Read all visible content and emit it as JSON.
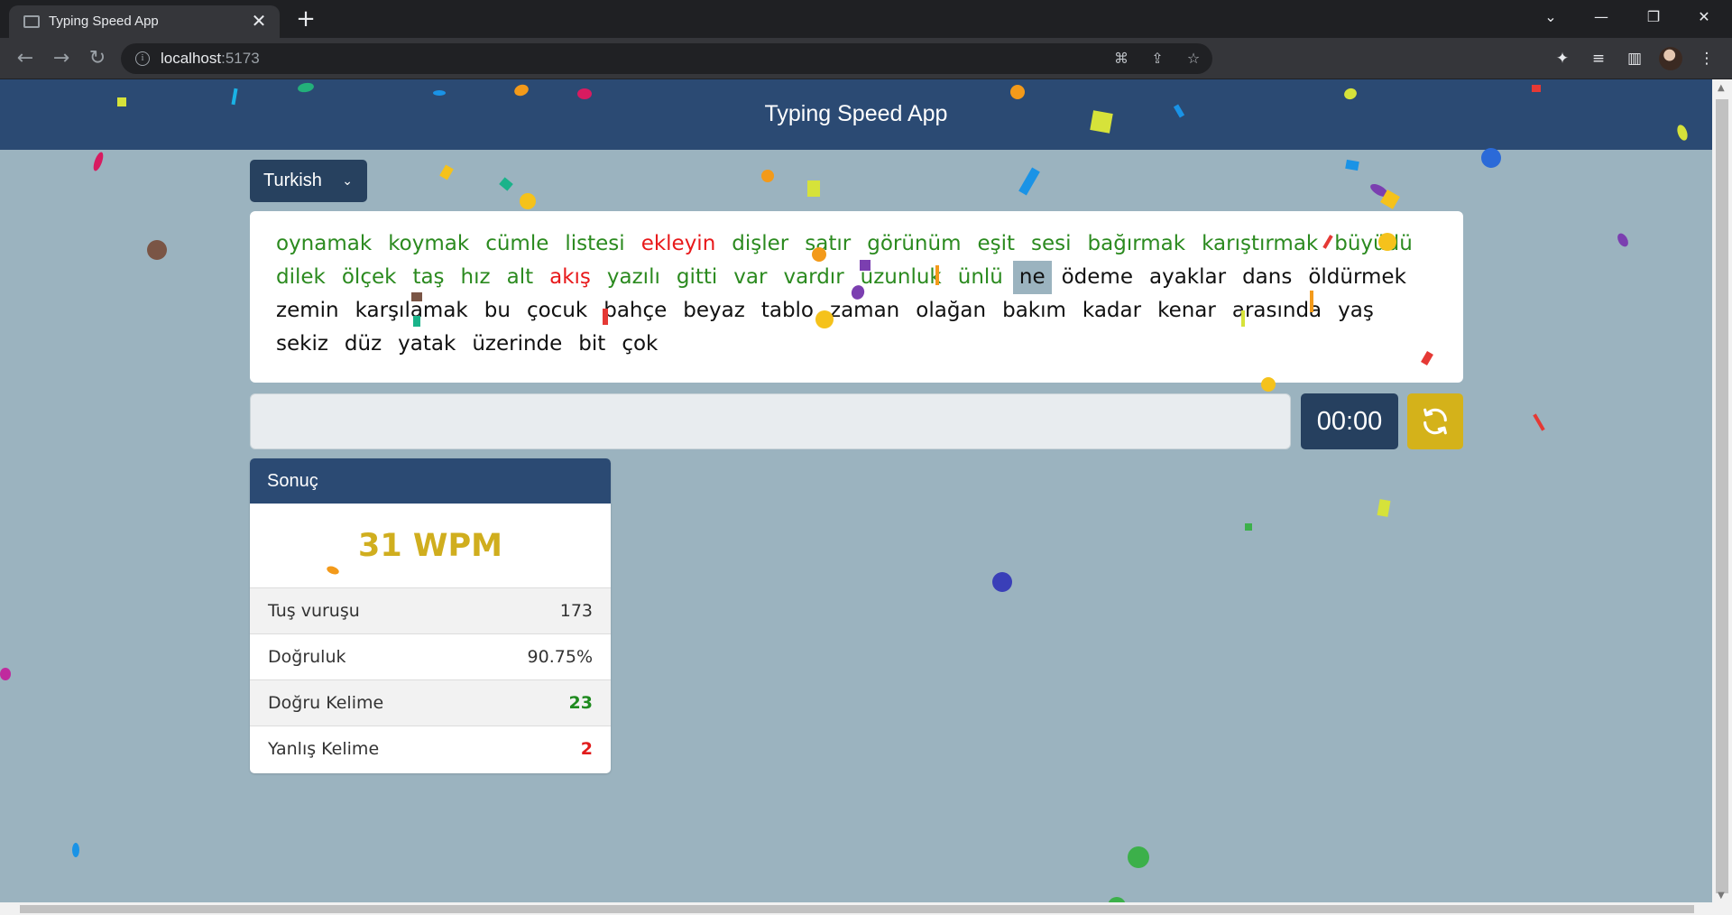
{
  "browser": {
    "tab_title": "Typing Speed App",
    "url_host": "localhost",
    "url_port": ":5173"
  },
  "app": {
    "title": "Typing Speed App",
    "language": "Turkish"
  },
  "words": [
    {
      "text": "oynamak",
      "state": "correct"
    },
    {
      "text": "koymak",
      "state": "correct"
    },
    {
      "text": "cümle",
      "state": "correct"
    },
    {
      "text": "listesi",
      "state": "correct"
    },
    {
      "text": "ekleyin",
      "state": "wrong"
    },
    {
      "text": "dişler",
      "state": "correct"
    },
    {
      "text": "satır",
      "state": "correct"
    },
    {
      "text": "görünüm",
      "state": "correct"
    },
    {
      "text": "eşit",
      "state": "correct"
    },
    {
      "text": "sesi",
      "state": "correct"
    },
    {
      "text": "bağırmak",
      "state": "correct"
    },
    {
      "text": "karıştırmak",
      "state": "correct"
    },
    {
      "text": "büyüdü",
      "state": "correct"
    },
    {
      "text": "dilek",
      "state": "correct"
    },
    {
      "text": "ölçek",
      "state": "correct"
    },
    {
      "text": "taş",
      "state": "correct"
    },
    {
      "text": "hız",
      "state": "correct"
    },
    {
      "text": "alt",
      "state": "correct"
    },
    {
      "text": "akış",
      "state": "wrong"
    },
    {
      "text": "yazılı",
      "state": "correct"
    },
    {
      "text": "gitti",
      "state": "correct"
    },
    {
      "text": "var",
      "state": "correct"
    },
    {
      "text": "vardır",
      "state": "correct"
    },
    {
      "text": "uzunluk",
      "state": "correct"
    },
    {
      "text": "ünlü",
      "state": "correct"
    },
    {
      "text": "ne",
      "state": "current"
    },
    {
      "text": "ödeme",
      "state": "pending"
    },
    {
      "text": "ayaklar",
      "state": "pending"
    },
    {
      "text": "dans",
      "state": "pending"
    },
    {
      "text": "öldürmek",
      "state": "pending"
    },
    {
      "text": "zemin",
      "state": "pending"
    },
    {
      "text": "karşılamak",
      "state": "pending"
    },
    {
      "text": "bu",
      "state": "pending"
    },
    {
      "text": "çocuk",
      "state": "pending"
    },
    {
      "text": "bahçe",
      "state": "pending"
    },
    {
      "text": "beyaz",
      "state": "pending"
    },
    {
      "text": "tablo",
      "state": "pending"
    },
    {
      "text": "zaman",
      "state": "pending"
    },
    {
      "text": "olağan",
      "state": "pending"
    },
    {
      "text": "bakım",
      "state": "pending"
    },
    {
      "text": "kadar",
      "state": "pending"
    },
    {
      "text": "kenar",
      "state": "pending"
    },
    {
      "text": "arasında",
      "state": "pending"
    },
    {
      "text": "yaş",
      "state": "pending"
    },
    {
      "text": "sekiz",
      "state": "pending"
    },
    {
      "text": "düz",
      "state": "pending"
    },
    {
      "text": "yatak",
      "state": "pending"
    },
    {
      "text": "üzerinde",
      "state": "pending"
    },
    {
      "text": "bit",
      "state": "pending"
    },
    {
      "text": "çok",
      "state": "pending"
    }
  ],
  "input": {
    "value": ""
  },
  "timer": "00:00",
  "result": {
    "title": "Sonuç",
    "wpm": "31 WPM",
    "rows": [
      {
        "label": "Tuş vuruşu",
        "value": "173",
        "tone": "plain"
      },
      {
        "label": "Doğruluk",
        "value": "90.75%",
        "tone": "plain"
      },
      {
        "label": "Doğru Kelime",
        "value": "23",
        "tone": "green"
      },
      {
        "label": "Yanlış Kelime",
        "value": "2",
        "tone": "red"
      }
    ]
  },
  "colors": {
    "header": "#2b4a73",
    "background": "#9bb3bf",
    "correct": "#2b8a1f",
    "wrong": "#e8191b",
    "accent": "#d4b21a"
  },
  "icons": {
    "tab_favicon": "favicon-icon",
    "reset": "refresh-icon",
    "language_chevron": "chevron-down-icon"
  }
}
